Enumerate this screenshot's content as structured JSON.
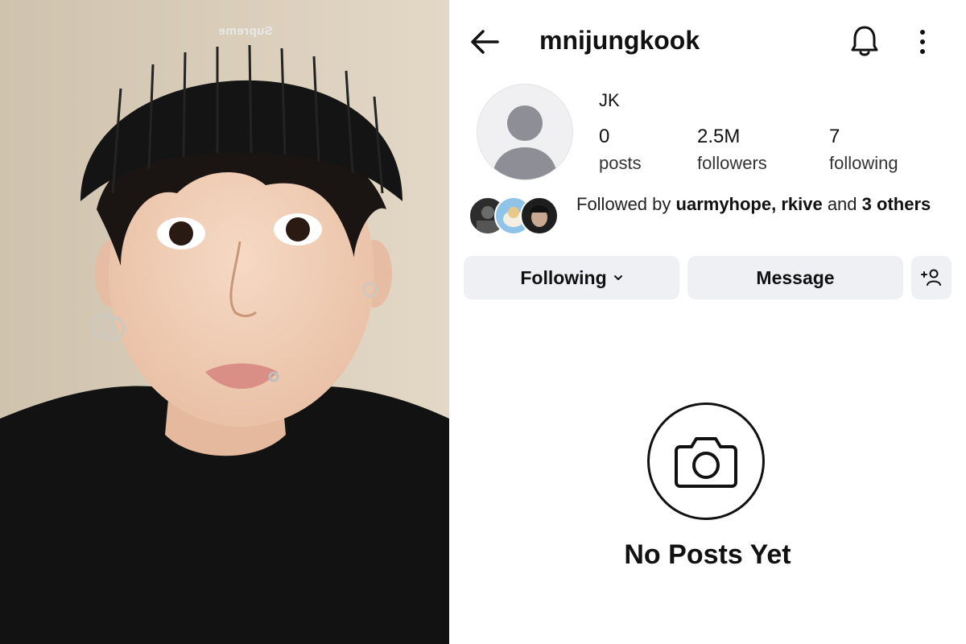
{
  "profile": {
    "username": "mnijungkook",
    "display_name": "JK",
    "stats": [
      {
        "value": "0",
        "label": "posts"
      },
      {
        "value": "2.5M",
        "label": "followers"
      },
      {
        "value": "7",
        "label": "following"
      }
    ],
    "followed_by": {
      "prefix": "Followed by ",
      "names": "uarmyhope, rkive",
      "connector": " and ",
      "count": "3",
      "suffix": "others"
    }
  },
  "buttons": {
    "following": "Following",
    "message": "Message",
    "add_user": "+ person"
  },
  "empty_state": {
    "title": "No Posts Yet"
  },
  "photo": {
    "beanie_text": "Supreme"
  },
  "icons": [
    "back-arrow-icon",
    "bell-icon",
    "more-vertical-icon",
    "chevron-down-icon",
    "add-person-icon",
    "camera-icon"
  ]
}
